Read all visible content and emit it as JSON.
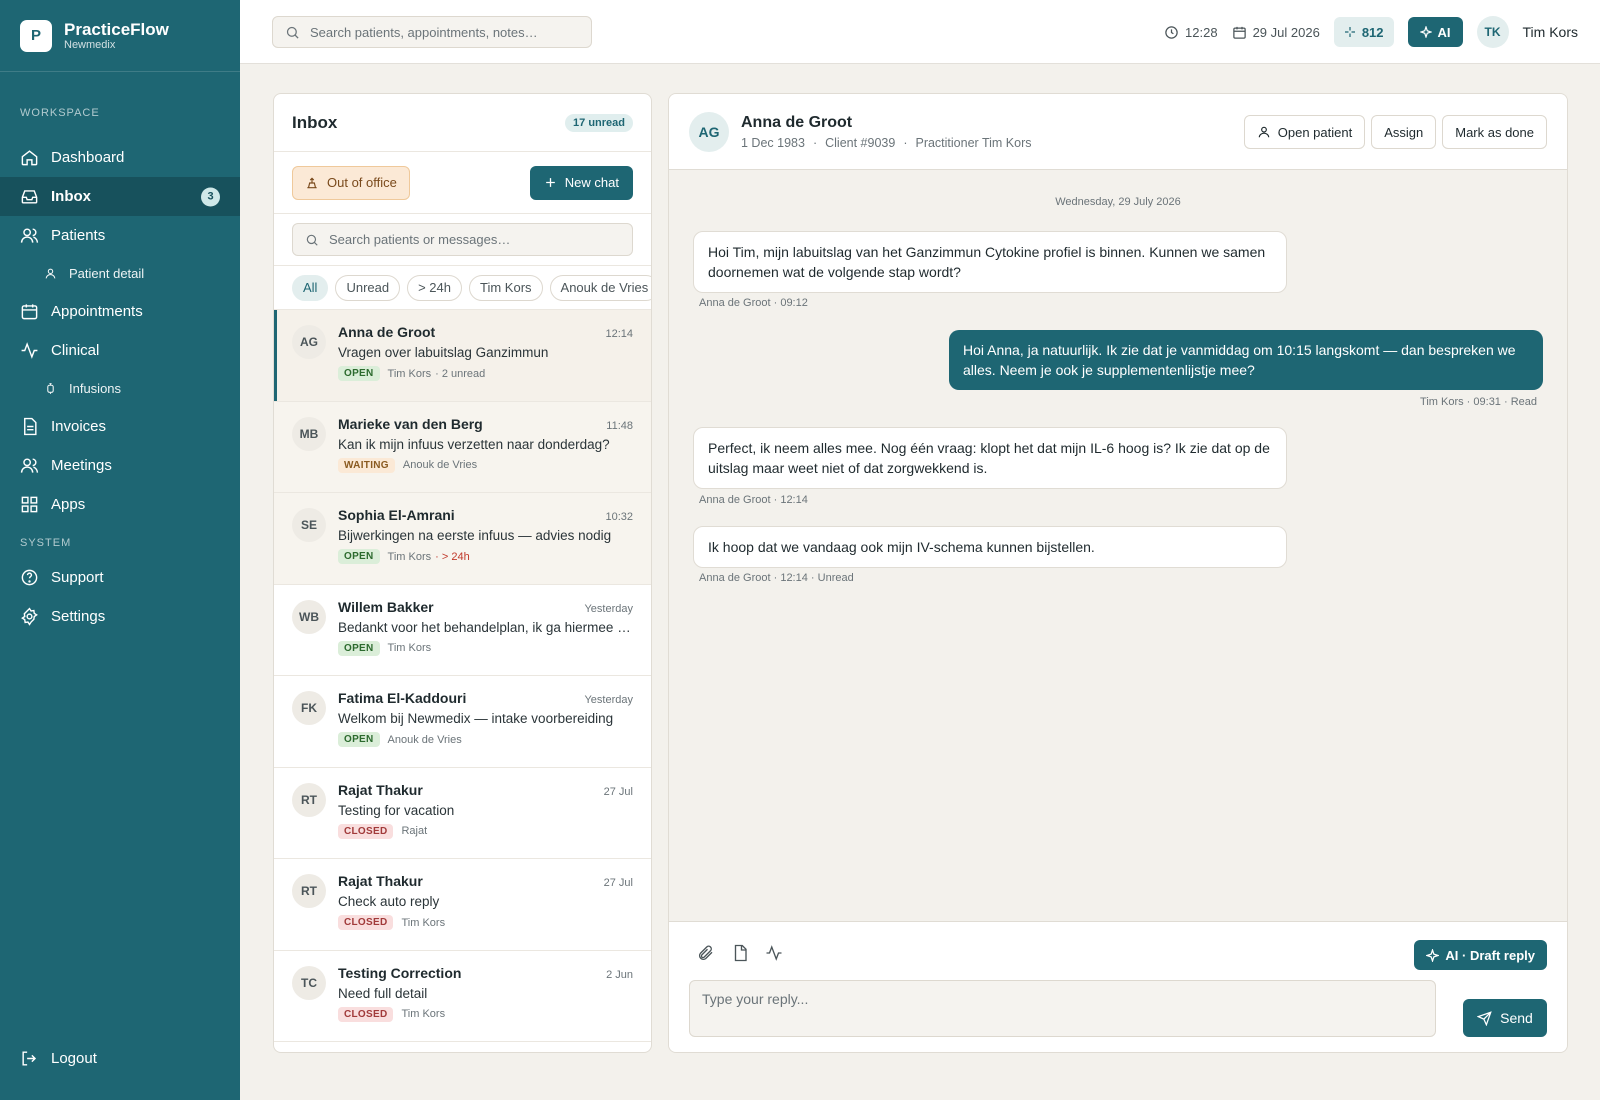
{
  "brand": {
    "logo_letter": "P",
    "name": "PracticeFlow",
    "sub": "Newmedix"
  },
  "nav": {
    "workspace_label": "WORKSPACE",
    "system_label": "SYSTEM",
    "items": [
      {
        "label": "Dashboard",
        "icon": "home-icon"
      },
      {
        "label": "Inbox",
        "icon": "inbox-icon",
        "badge": "3",
        "active": true
      },
      {
        "label": "Patients",
        "icon": "users-icon"
      },
      {
        "label": "Patient detail",
        "icon": "user-icon",
        "sub": true
      },
      {
        "label": "Appointments",
        "icon": "calendar-icon"
      },
      {
        "label": "Clinical",
        "icon": "activity-icon"
      },
      {
        "label": "Infusions",
        "icon": "infusion-icon",
        "sub": true
      },
      {
        "label": "Invoices",
        "icon": "file-icon"
      },
      {
        "label": "Meetings",
        "icon": "users-icon"
      },
      {
        "label": "Apps",
        "icon": "grid-icon"
      }
    ],
    "system_items": [
      {
        "label": "Support",
        "icon": "help-icon"
      },
      {
        "label": "Settings",
        "icon": "gear-icon"
      }
    ],
    "logout": "Logout"
  },
  "topbar": {
    "search_placeholder": "Search patients, appointments, notes…",
    "time": "12:28",
    "date": "29 Jul 2026",
    "credits": "812",
    "ai_label": "AI",
    "user_initials": "TK",
    "user_name": "Tim Kors"
  },
  "inbox": {
    "title": "Inbox",
    "unread": "17 unread",
    "out_of_office": "Out of office",
    "new_chat": "New chat",
    "search_placeholder": "Search patients or messages…",
    "filters": [
      "All",
      "Unread",
      "> 24h",
      "Tim Kors",
      "Anouk de Vries"
    ],
    "conversations": [
      {
        "initials": "AG",
        "name": "Anna de Groot",
        "time": "12:14",
        "preview": "Vragen over labuitslag Ganzimmun",
        "status": "OPEN",
        "owner": "Tim Kors",
        "extra": "· 2 unread",
        "extra_alert": false
      },
      {
        "initials": "MB",
        "name": "Marieke van den Berg",
        "time": "11:48",
        "preview": "Kan ik mijn infuus verzetten naar donderdag?",
        "status": "WAITING",
        "owner": "Anouk de Vries",
        "extra": "",
        "extra_alert": false
      },
      {
        "initials": "SE",
        "name": "Sophia El-Amrani",
        "time": "10:32",
        "preview": "Bijwerkingen na eerste infuus — advies nodig",
        "status": "OPEN",
        "owner": "Tim Kors",
        "extra": "· > 24h",
        "extra_alert": true
      },
      {
        "initials": "WB",
        "name": "Willem Bakker",
        "time": "Yesterday",
        "preview": "Bedankt voor het behandelplan, ik ga hiermee aan de slag",
        "status": "OPEN",
        "owner": "Tim Kors",
        "extra": "",
        "extra_alert": false
      },
      {
        "initials": "FK",
        "name": "Fatima El-Kaddouri",
        "time": "Yesterday",
        "preview": "Welkom bij Newmedix — intake voorbereiding",
        "status": "OPEN",
        "owner": "Anouk de Vries",
        "extra": "",
        "extra_alert": false
      },
      {
        "initials": "RT",
        "name": "Rajat Thakur",
        "time": "27 Jul",
        "preview": "Testing for vacation",
        "status": "CLOSED",
        "owner": "Rajat",
        "extra": "",
        "extra_alert": false
      },
      {
        "initials": "RT",
        "name": "Rajat Thakur",
        "time": "27 Jul",
        "preview": "Check auto reply",
        "status": "CLOSED",
        "owner": "Tim Kors",
        "extra": "",
        "extra_alert": false
      },
      {
        "initials": "TC",
        "name": "Testing Correction",
        "time": "2 Jun",
        "preview": "Need full detail",
        "status": "CLOSED",
        "owner": "Tim Kors",
        "extra": "",
        "extra_alert": false
      }
    ]
  },
  "chat": {
    "initials": "AG",
    "name": "Anna de Groot",
    "dob": "1 Dec 1983",
    "client": "Client #9039",
    "practitioner": "Practitioner Tim Kors",
    "actions": {
      "open_patient": "Open patient",
      "assign": "Assign",
      "mark_done": "Mark as done"
    },
    "day_label": "Wednesday, 29 July 2026",
    "messages": [
      {
        "direction": "in",
        "text": "Hoi Tim, mijn labuitslag van het Ganzimmun Cytokine profiel is binnen. Kunnen we samen doornemen wat de volgende stap wordt?",
        "meta": "Anna de Groot · 09:12"
      },
      {
        "direction": "out",
        "text": "Hoi Anna, ja natuurlijk. Ik zie dat je vanmiddag om 10:15 langskomt — dan bespreken we alles. Neem je ook je supplementenlijstje mee?",
        "meta": "Tim Kors · 09:31 · Read"
      },
      {
        "direction": "in",
        "text": "Perfect, ik neem alles mee. Nog één vraag: klopt het dat mijn IL-6 hoog is? Ik zie dat op de uitslag maar weet niet of dat zorgwekkend is.",
        "meta": "Anna de Groot · 12:14"
      },
      {
        "direction": "in",
        "text": "Ik hoop dat we vandaag ook mijn IV-schema kunnen bijstellen.",
        "meta": "Anna de Groot · 12:14 · Unread"
      }
    ],
    "composer": {
      "draft_label": "AI · Draft reply",
      "placeholder": "Type your reply...",
      "send": "Send"
    }
  },
  "colors": {
    "primary": "#1e6673",
    "sidebar": "#1e6673",
    "background": "#f3f1ec"
  }
}
